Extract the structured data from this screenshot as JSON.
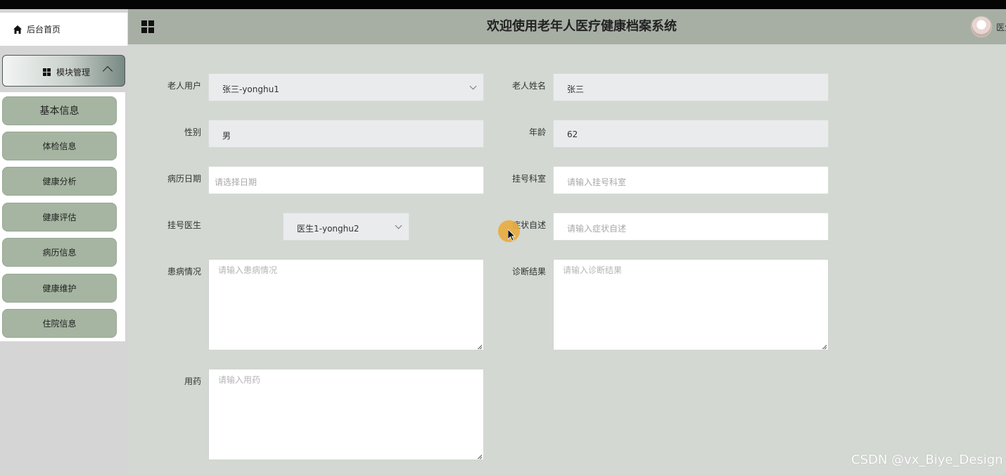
{
  "header": {
    "title": "欢迎使用老年人医疗健康档案系统",
    "user_name": "医生"
  },
  "sidebar": {
    "home_label": "后台首页",
    "module_label": "模块管理",
    "items": [
      {
        "label": "基本信息"
      },
      {
        "label": "体检信息"
      },
      {
        "label": "健康分析"
      },
      {
        "label": "健康评估"
      },
      {
        "label": "病历信息"
      },
      {
        "label": "健康维护"
      },
      {
        "label": "住院信息"
      }
    ]
  },
  "form": {
    "elder_user": {
      "label": "老人用户",
      "value": "张三-yonghu1"
    },
    "elder_name": {
      "label": "老人姓名",
      "value": "张三"
    },
    "gender": {
      "label": "性别",
      "value": "男"
    },
    "age": {
      "label": "年龄",
      "value": "62"
    },
    "record_date": {
      "label": "病历日期",
      "placeholder": "请选择日期"
    },
    "department": {
      "label": "挂号科室",
      "placeholder": "请输入挂号科室"
    },
    "doctor": {
      "label": "挂号医生",
      "value": "医生1-yonghu2"
    },
    "symptoms": {
      "label": "症状自述",
      "placeholder": "请输入症状自述"
    },
    "condition": {
      "label": "患病情况",
      "placeholder": "请输入患病情况"
    },
    "diagnosis": {
      "label": "诊断结果",
      "placeholder": "请输入诊断结果"
    },
    "medication": {
      "label": "用药",
      "placeholder": "请输入用药"
    }
  },
  "watermark": "CSDN @vx_Biye_Design"
}
